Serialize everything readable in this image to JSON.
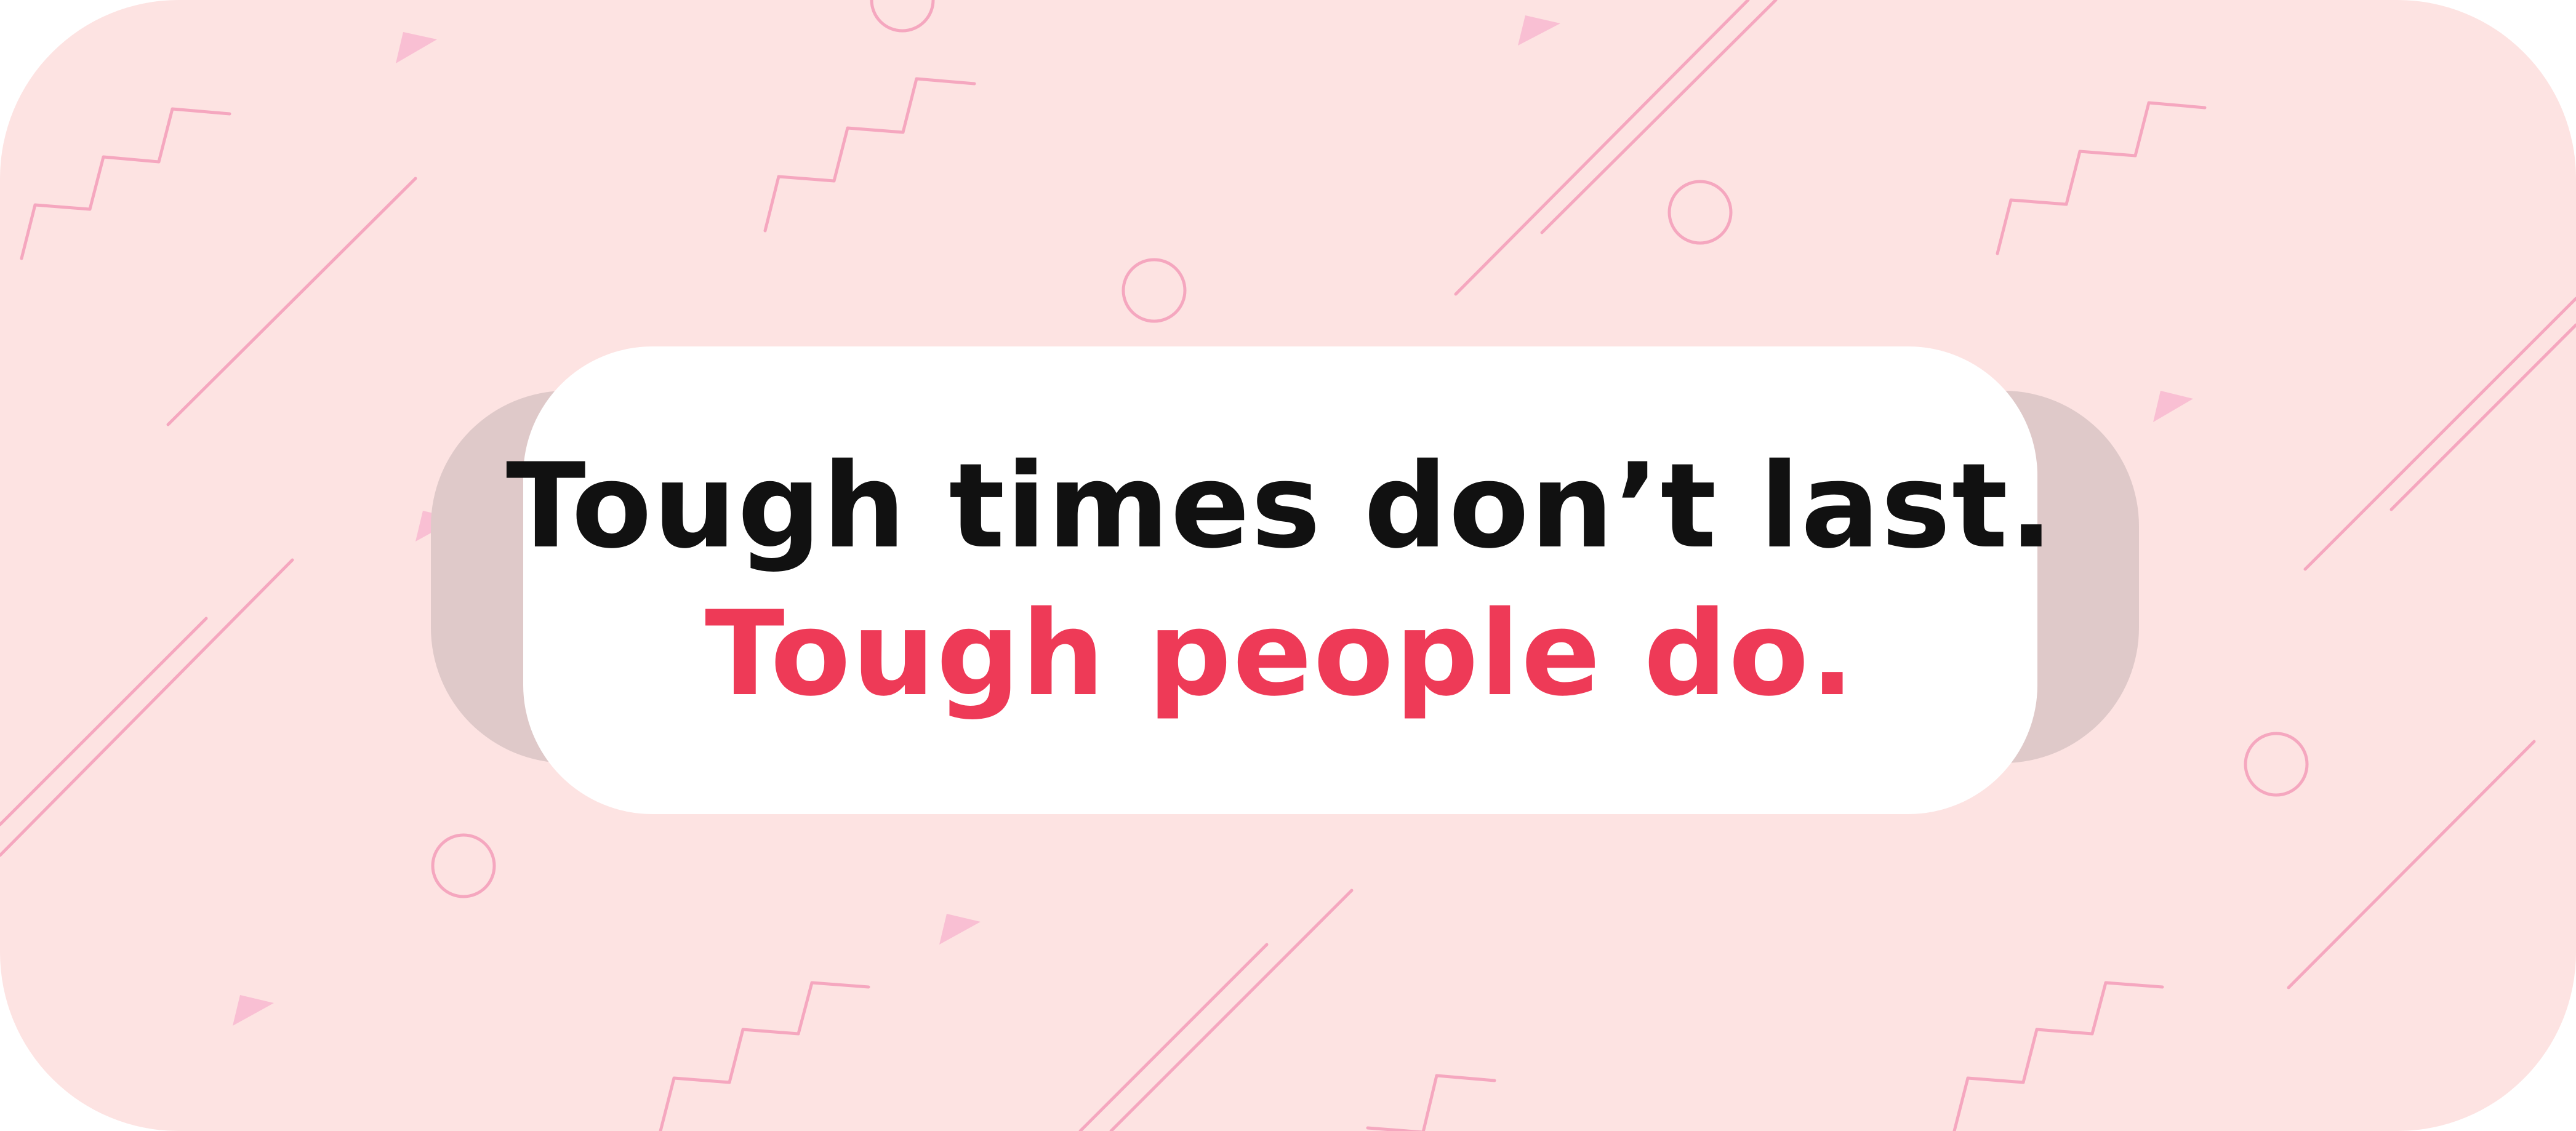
{
  "quote": {
    "line1": "Tough times don’t last.",
    "line2": "Tough people do."
  },
  "colors": {
    "background": "#FDE3E2",
    "pattern_stroke": "#F5A7BF",
    "pattern_triangle": "#F9BFD3",
    "shadow_card": "#DFC9C9",
    "card": "#FFFFFF",
    "line1_text": "#111111",
    "line2_text": "#EE3A57"
  },
  "icons": {
    "decorations": [
      "zigzag-line-icon",
      "diagonal-line-icon",
      "circle-outline-icon",
      "triangle-icon"
    ]
  }
}
